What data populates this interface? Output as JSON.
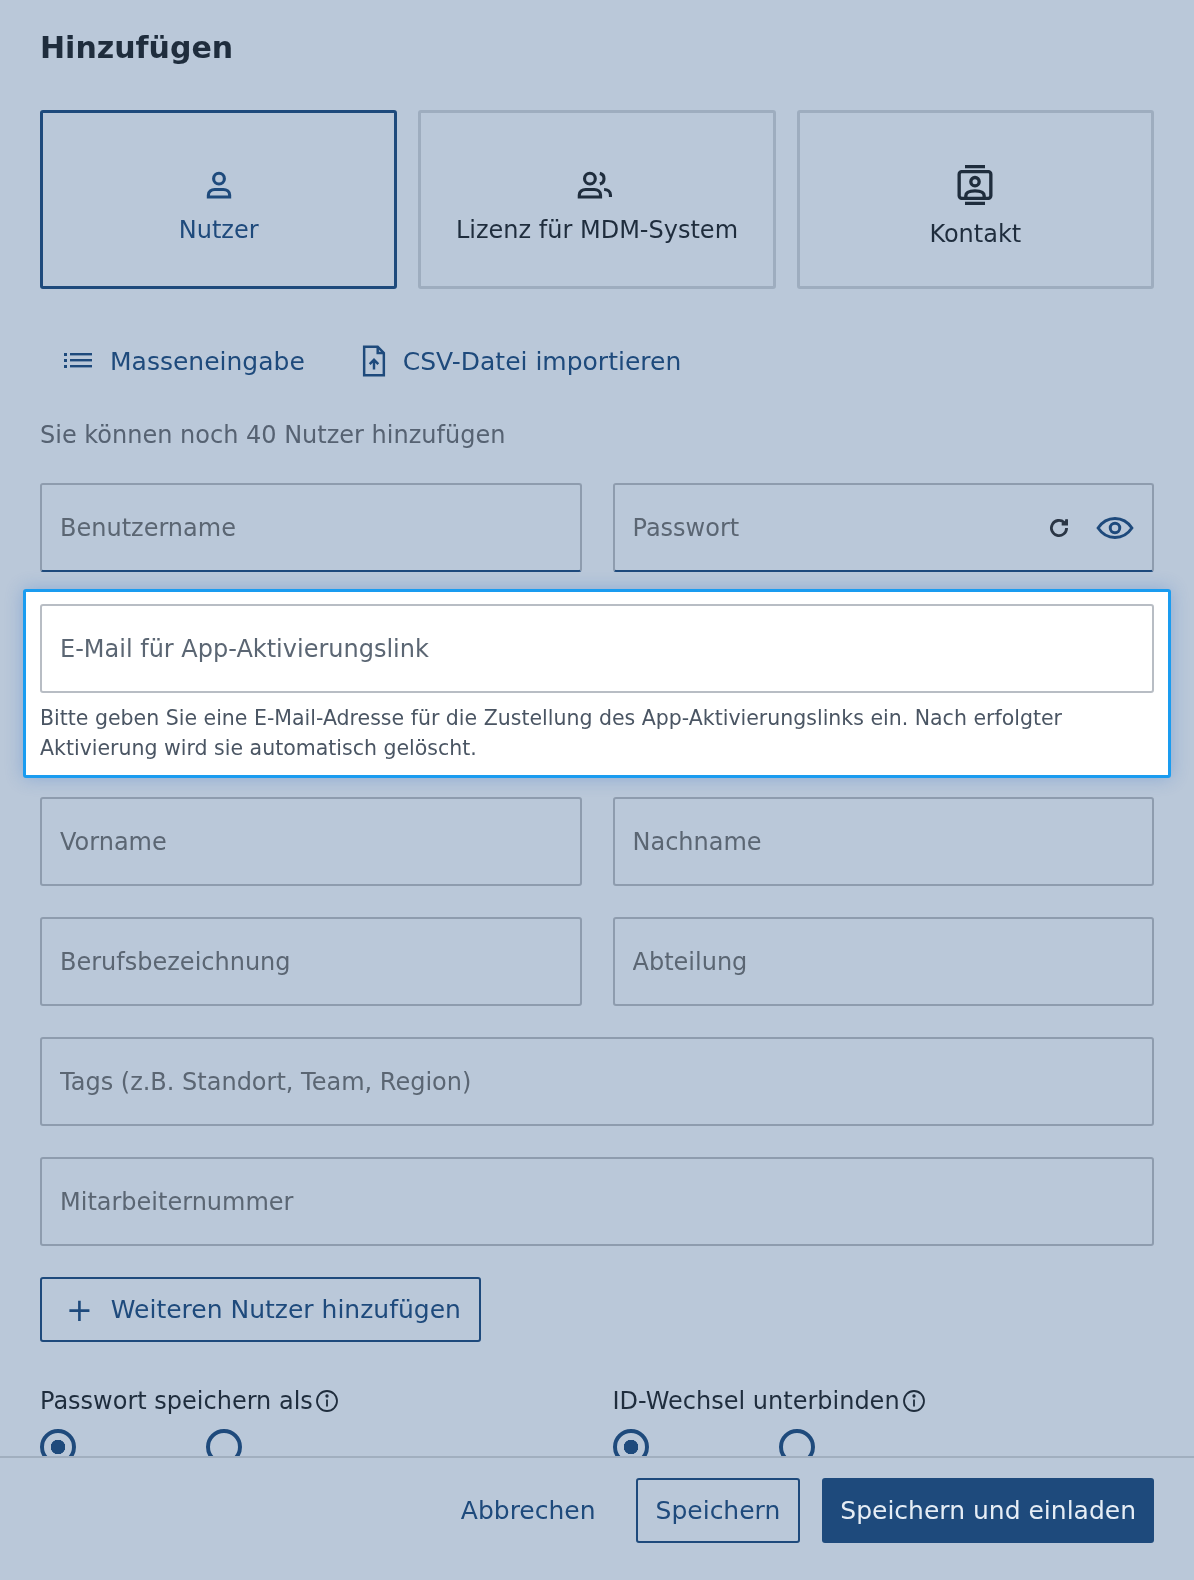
{
  "title": "Hinzufügen",
  "tiles": [
    {
      "label": "Nutzer",
      "kind": "person",
      "selected": true
    },
    {
      "label": "Lizenz für MDM-System",
      "kind": "license",
      "selected": false
    },
    {
      "label": "Kontakt",
      "kind": "contact",
      "selected": false
    }
  ],
  "actions": [
    {
      "label": "Masseneingabe",
      "kind": "bulk"
    },
    {
      "label": "CSV-Datei importieren",
      "kind": "import"
    }
  ],
  "info": "Sie können noch 40 Nutzer hinzufügen",
  "fields": [
    {
      "placeholder": "Benutzername",
      "kind": "half"
    },
    {
      "placeholder": "Passwort",
      "kind": "password"
    },
    {
      "placeholder": "E-Mail für App-Aktivierungslink",
      "kind": "focused",
      "hint": "Bitte geben Sie eine E-Mail-Adresse für die Zustellung des App-Aktivierungslinks ein. Nach erfolgter Aktivierung wird sie automatisch gelöscht."
    },
    {
      "placeholder": "Vorname",
      "kind": "half"
    },
    {
      "placeholder": "Nachname",
      "kind": "half"
    },
    {
      "placeholder": "Berufsbezeichnung",
      "kind": "half"
    },
    {
      "placeholder": "Abteilung",
      "kind": "half"
    },
    {
      "placeholder": "Tags (z.B. Standort, Team, Region)",
      "kind": "full"
    },
    {
      "placeholder": "Mitarbeiternummer",
      "kind": "full"
    }
  ],
  "add_button": {
    "icon": "+",
    "label": "Weiteren Nutzer hinzufügen"
  },
  "options": [
    {
      "label": "Passwort speichern als",
      "radios": [
        {
          "selected": true
        },
        {
          "selected": false
        }
      ]
    },
    {
      "label": "ID-Wechsel unterbinden",
      "radios": [
        {
          "selected": true
        },
        {
          "selected": false
        }
      ]
    }
  ],
  "footer": [
    {
      "label": "Abbrechen",
      "kind": "text"
    },
    {
      "label": "Speichern",
      "kind": "outline"
    },
    {
      "label": "Speichern und einladen",
      "kind": "primary"
    }
  ]
}
